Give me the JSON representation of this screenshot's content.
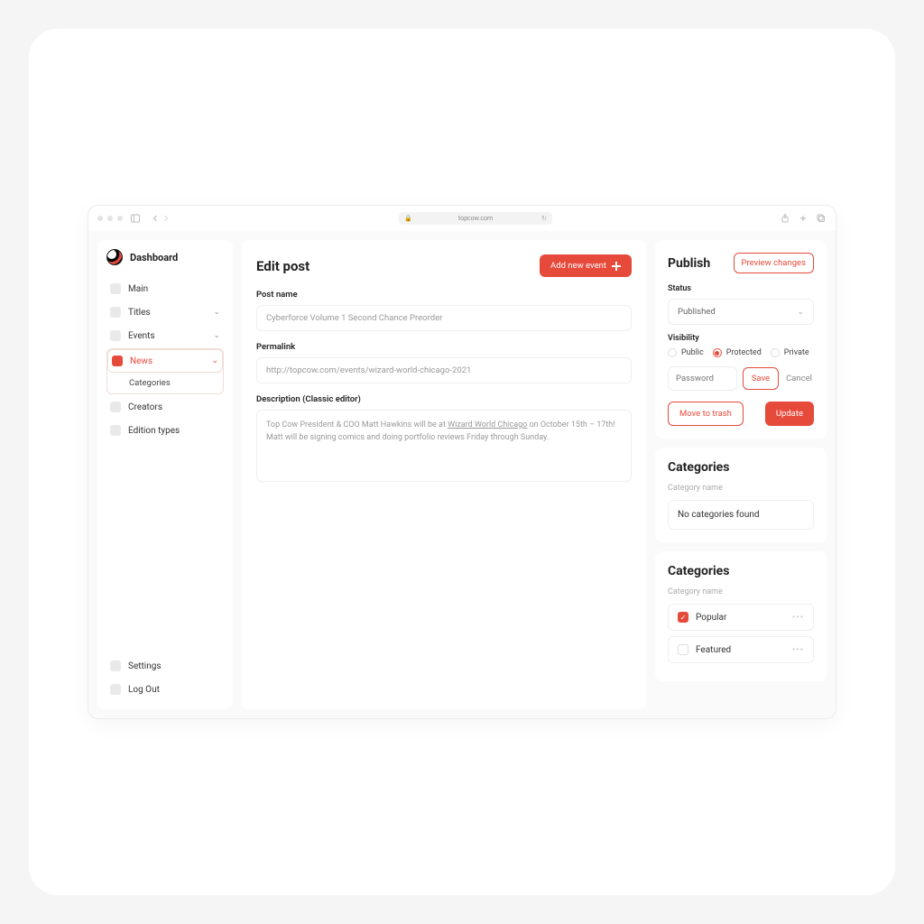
{
  "browser": {
    "url": "topcow.com"
  },
  "sidebar": {
    "title": "Dashboard",
    "items": {
      "main": "Main",
      "titles": "Titles",
      "events": "Events",
      "news": "News",
      "categories": "Categories",
      "creators": "Creators",
      "edition_types": "Edition types"
    },
    "footer": {
      "settings": "Settings",
      "logout": "Log Out"
    }
  },
  "main": {
    "title": "Edit post",
    "add_event": "Add new event",
    "post_name_label": "Post name",
    "post_name_value": "Cyberforce Volume 1 Second Chance Preorder",
    "permalink_label": "Permalink",
    "permalink_value": "http://topcow.com/events/wizard-world-chicago-2021",
    "description_label": "Description (Classic editor)",
    "description_prefix": "Top Cow President & COO Matt Hawkins will be at ",
    "description_link": "Wizard World Chicago",
    "description_suffix": " on October 15th – 17th! Matt will be signing comics and doing portfolio reviews Friday through Sunday."
  },
  "publish": {
    "title": "Publish",
    "preview": "Preview changes",
    "status_label": "Status",
    "status_value": "Published",
    "visibility_label": "Visibility",
    "vis_public": "Public",
    "vis_protected": "Protected",
    "vis_private": "Private",
    "password_placeholder": "Password",
    "save": "Save",
    "cancel": "Cancel",
    "move_to_trash": "Move to trash",
    "update": "Update"
  },
  "categories1": {
    "title": "Categories",
    "sub": "Category name",
    "empty": "No categories found"
  },
  "categories2": {
    "title": "Categories",
    "sub": "Category name",
    "items": {
      "popular": "Popular",
      "featured": "Featured"
    }
  }
}
